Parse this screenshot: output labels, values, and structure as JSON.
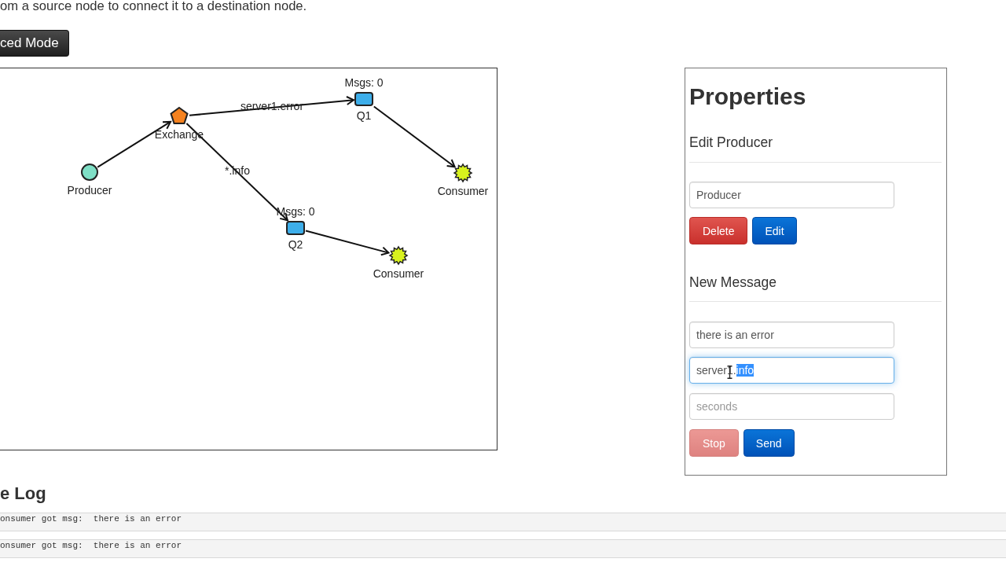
{
  "instructions": "om a source node to connect it to a destination node.",
  "mode_button": {
    "label": "ced Mode"
  },
  "graph": {
    "root": {
      "kind": "producer",
      "label": "Producer",
      "children": [
        {
          "kind": "exchange",
          "label": "Exchange",
          "children": [
            {
              "kind": "queue",
              "label": "Q1",
              "count": "Msgs: 0",
              "binding": "server1.error",
              "children": [
                {
                  "kind": "consumer",
                  "label": "Consumer"
                }
              ]
            },
            {
              "kind": "queue",
              "label": "Q2",
              "count": "Msgs: 0",
              "binding": "*.info",
              "children": [
                {
                  "kind": "consumer",
                  "label": "Consumer"
                }
              ]
            }
          ]
        }
      ]
    }
  },
  "properties": {
    "title": "Properties",
    "edit_section": {
      "heading": "Edit Producer",
      "fields": [
        {
          "value": "Producer",
          "focused": false
        }
      ],
      "buttons": [
        {
          "label": "Delete",
          "kind": "danger",
          "disabled": false
        },
        {
          "label": "Edit",
          "kind": "primary",
          "disabled": false
        }
      ]
    },
    "message_section": {
      "heading": "New Message",
      "fields": [
        {
          "value": "there is an error",
          "focused": false
        },
        {
          "value": "server1.",
          "selected_text": "info",
          "focused": true
        },
        {
          "placeholder": "seconds",
          "focused": false
        }
      ],
      "buttons": [
        {
          "label": "Stop",
          "kind": "danger",
          "disabled": true
        },
        {
          "label": "Send",
          "kind": "primary",
          "disabled": false
        }
      ]
    }
  },
  "log": {
    "heading": "e Log",
    "entries": [
      "onsumer got msg:  there is an error",
      "onsumer got msg:  there is an error"
    ]
  }
}
